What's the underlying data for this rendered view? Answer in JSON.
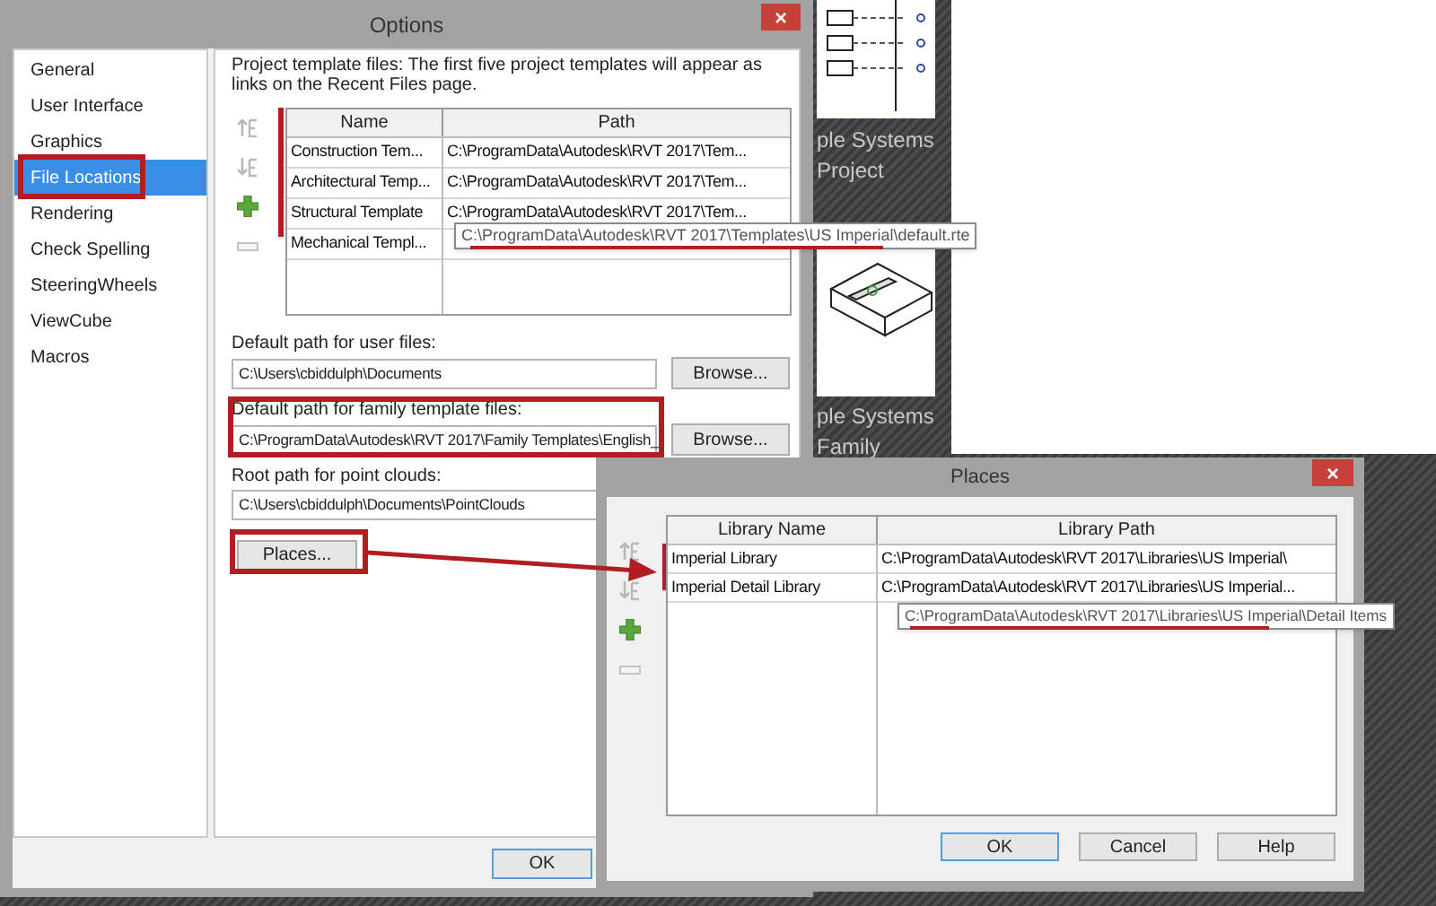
{
  "start_page": {
    "items": [
      {
        "caption_lines": [
          "ple Systems",
          "Project"
        ]
      },
      {
        "caption_lines": [
          "ple Systems",
          "Family"
        ]
      }
    ]
  },
  "options_dialog": {
    "title": "Options",
    "close": "×",
    "sidebar": [
      {
        "label": "General",
        "selected": false
      },
      {
        "label": "User Interface",
        "selected": false
      },
      {
        "label": "Graphics",
        "selected": false
      },
      {
        "label": "File Locations",
        "selected": true
      },
      {
        "label": "Rendering",
        "selected": false
      },
      {
        "label": "Check Spelling",
        "selected": false
      },
      {
        "label": "SteeringWheels",
        "selected": false
      },
      {
        "label": "ViewCube",
        "selected": false
      },
      {
        "label": "Macros",
        "selected": false
      }
    ],
    "template_note": "Project template files:  The first five project templates will appear as links on the Recent Files page.",
    "template_table": {
      "columns": [
        "Name",
        "Path"
      ],
      "rows": [
        {
          "name": "Construction Tem...",
          "path": "C:\\ProgramData\\Autodesk\\RVT 2017\\Tem..."
        },
        {
          "name": "Architectural Temp...",
          "path": "C:\\ProgramData\\Autodesk\\RVT 2017\\Tem..."
        },
        {
          "name": "Structural Template",
          "path": "C:\\ProgramData\\Autodesk\\RVT 2017\\Tem..."
        },
        {
          "name": "Mechanical Templ..."
        }
      ]
    },
    "tooltip": "C:\\ProgramData\\Autodesk\\RVT 2017\\Templates\\US Imperial\\default.rte",
    "path_fields": [
      {
        "label": "Default path for user files:",
        "value": "C:\\Users\\cbiddulph\\Documents",
        "button": "Browse..."
      },
      {
        "label": "Default path for family template files:",
        "value": "C:\\ProgramData\\Autodesk\\RVT 2017\\Family Templates\\English_",
        "button": "Browse..."
      },
      {
        "label": "Root path for point clouds:",
        "value": "C:\\Users\\cbiddulph\\Documents\\PointClouds"
      }
    ],
    "places_button": "Places...",
    "ok_button": "OK"
  },
  "places_dialog": {
    "title": "Places",
    "close": "×",
    "table": {
      "columns": [
        "Library Name",
        "Library Path"
      ],
      "rows": [
        {
          "name": "Imperial Library",
          "path": "C:\\ProgramData\\Autodesk\\RVT 2017\\Libraries\\US Imperial\\"
        },
        {
          "name": "Imperial Detail Library",
          "path": "C:\\ProgramData\\Autodesk\\RVT 2017\\Libraries\\US Imperial..."
        }
      ]
    },
    "tooltip": "C:\\ProgramData\\Autodesk\\RVT 2017\\Libraries\\US Imperial\\Detail Items",
    "buttons": [
      {
        "label": "OK",
        "default": true
      },
      {
        "label": "Cancel",
        "default": false
      },
      {
        "label": "Help",
        "default": false
      }
    ]
  }
}
